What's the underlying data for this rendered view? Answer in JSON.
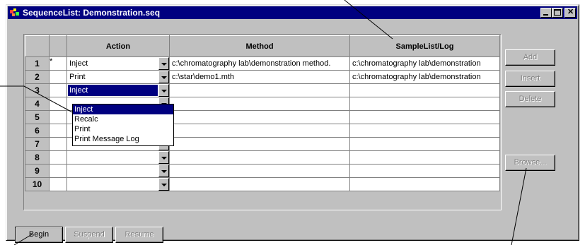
{
  "window": {
    "title": "SequenceList: Demonstration.seq"
  },
  "title_buttons": {
    "minimize": "_",
    "maximize": "□",
    "close": "✕"
  },
  "grid": {
    "headers": [
      "",
      "",
      "Action",
      "Method",
      "SampleList/Log"
    ],
    "rows": [
      {
        "num": "1",
        "marker": "*",
        "action": "Inject",
        "method": "c:\\chromatography lab\\demonstration method.",
        "sample": "c:\\chromatography lab\\demonstration"
      },
      {
        "num": "2",
        "marker": "",
        "action": "Print",
        "method": "c:\\star\\demo1.mth",
        "sample": "c:\\chromatography lab\\demonstration"
      },
      {
        "num": "3",
        "marker": "",
        "action": "Inject",
        "method": "",
        "sample": ""
      },
      {
        "num": "4",
        "marker": "",
        "action": "",
        "method": "",
        "sample": ""
      },
      {
        "num": "5",
        "marker": "",
        "action": "",
        "method": "",
        "sample": ""
      },
      {
        "num": "6",
        "marker": "",
        "action": "",
        "method": "",
        "sample": ""
      },
      {
        "num": "7",
        "marker": "",
        "action": "",
        "method": "",
        "sample": ""
      },
      {
        "num": "8",
        "marker": "",
        "action": "",
        "method": "",
        "sample": ""
      },
      {
        "num": "9",
        "marker": "",
        "action": "",
        "method": "",
        "sample": ""
      },
      {
        "num": "10",
        "marker": "",
        "action": "",
        "method": "",
        "sample": ""
      }
    ]
  },
  "dropdown": {
    "options": [
      "Inject",
      "Recalc",
      "Print",
      "Print Message Log"
    ],
    "highlighted": "Inject"
  },
  "side_buttons": {
    "add": "Add",
    "insert": "Insert",
    "delete": "Delete",
    "browse": "Browse..."
  },
  "bottom_buttons": {
    "begin": "Begin",
    "suspend": "Suspend",
    "resume": "Resume"
  }
}
